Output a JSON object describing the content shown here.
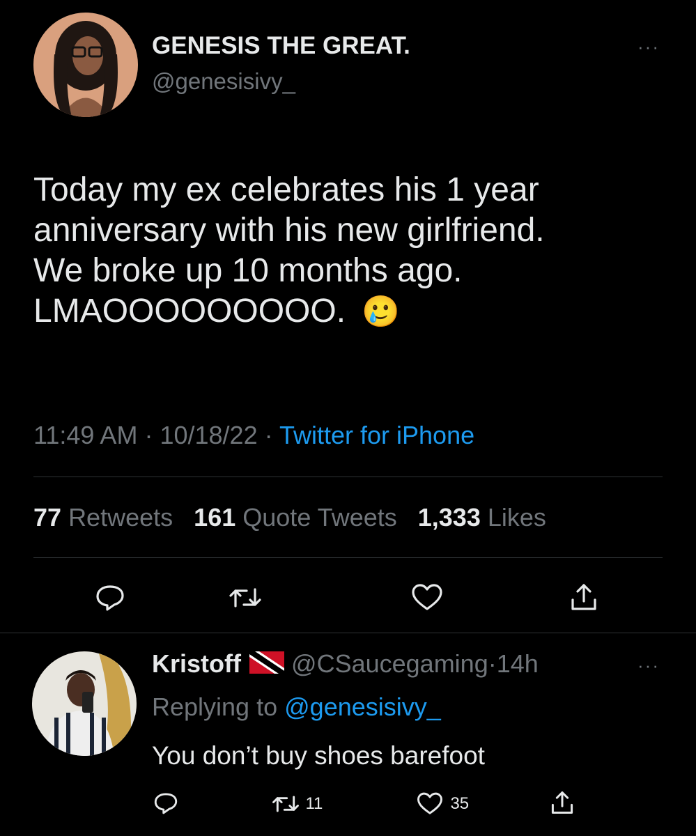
{
  "colors": {
    "background": "#000000",
    "text": "#e7e9ea",
    "muted": "#71767b",
    "link": "#1d9bf0",
    "divider": "#2f3336"
  },
  "main_tweet": {
    "display_name": "GENESIS THE GREAT.",
    "handle": "@genesisivy_",
    "more_label": "···",
    "text_lines": [
      "Today my ex celebrates his 1 year",
      "anniversary with his new girlfriend.",
      "We broke up 10 months ago.",
      "LMAOOOOOOOOO."
    ],
    "emoji": "🥲",
    "time": "11:49 AM",
    "date": "10/18/22",
    "separator": "·",
    "source": "Twitter for iPhone",
    "stats": {
      "retweets_count": "77",
      "retweets_label": "Retweets",
      "quotes_count": "161",
      "quotes_label": "Quote Tweets",
      "likes_count": "1,333",
      "likes_label": "Likes"
    },
    "actions": [
      "reply-icon",
      "retweet-icon",
      "like-icon",
      "share-icon"
    ]
  },
  "reply": {
    "display_name": "Kristoff",
    "flag": "Trinidad and Tobago flag",
    "handle": "@CSaucegaming",
    "separator": "·",
    "time": "14h",
    "more_label": "···",
    "replying_prefix": "Replying to",
    "replying_to": "@genesisivy_",
    "text": "You don’t buy shoes barefoot",
    "retweet_count": "11",
    "like_count": "35",
    "actions": [
      "reply-icon",
      "retweet-icon",
      "like-icon",
      "share-icon"
    ]
  }
}
